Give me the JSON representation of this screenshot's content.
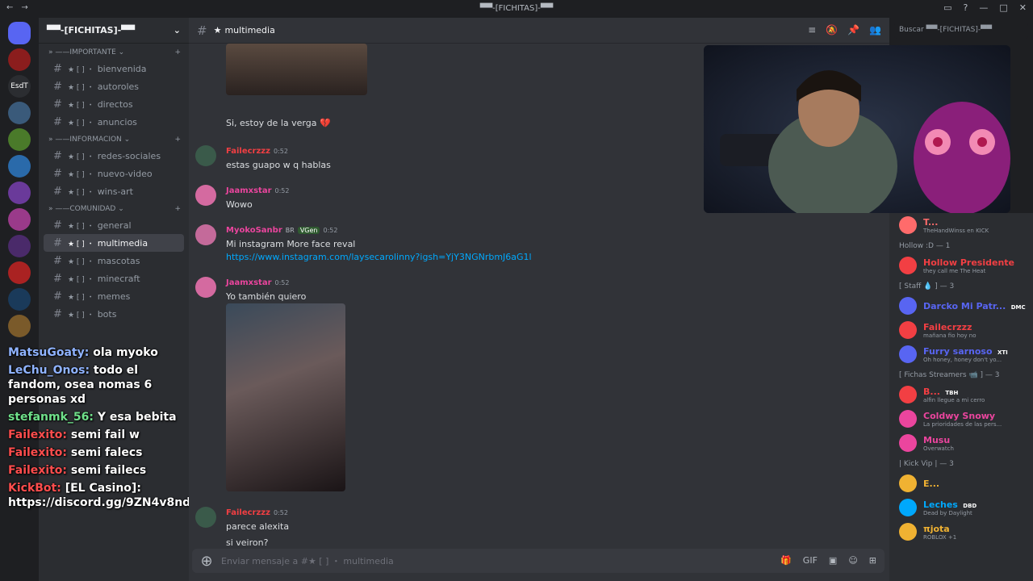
{
  "window": {
    "title": "▀▀-[FICHITAS]-▀▀"
  },
  "server_rail": {
    "items": [
      {
        "label": "",
        "color": "#5865f2",
        "icon": "discord-icon"
      },
      {
        "label": "",
        "color": "#8b1d1d"
      },
      {
        "label": "EsdT",
        "color": "#2b2d31"
      },
      {
        "label": "",
        "color": "#3a5a7a"
      },
      {
        "label": "",
        "color": "#4a7a2a"
      },
      {
        "label": "",
        "color": "#2a6aaa"
      },
      {
        "label": "",
        "color": "#6a3a9a"
      },
      {
        "label": "",
        "color": "#9a3a8a"
      },
      {
        "label": "",
        "color": "#4a2a6a"
      },
      {
        "label": "",
        "color": "#aa2222"
      },
      {
        "label": "",
        "color": "#1a3a5a"
      },
      {
        "label": "",
        "color": "#7a5a2a"
      }
    ]
  },
  "guild": {
    "name": "▀▀-[FICHITAS]-▀▀"
  },
  "sidebar": {
    "categories": [
      {
        "name": "IMPORTANTE",
        "channels": [
          {
            "name": "bienvenida"
          },
          {
            "name": "autoroles"
          },
          {
            "name": "directos"
          },
          {
            "name": "anuncios"
          }
        ]
      },
      {
        "name": "INFORMACION",
        "channels": [
          {
            "name": "redes-sociales"
          },
          {
            "name": "nuevo-video"
          },
          {
            "name": "wins-art"
          }
        ]
      },
      {
        "name": "COMUNIDAD",
        "channels": [
          {
            "name": "general"
          },
          {
            "name": "multimedia"
          },
          {
            "name": "mascotas"
          },
          {
            "name": "minecraft"
          },
          {
            "name": "memes"
          },
          {
            "name": "bots"
          }
        ]
      }
    ]
  },
  "stream_chat": [
    {
      "user": "MatsuGoaty",
      "text": "ola myoko"
    },
    {
      "user": "LeChu_Onos",
      "text": "todo el fandom, osea nomas 6 personas xd"
    },
    {
      "user": "stefanmk_56",
      "text": "Y esa bebita"
    },
    {
      "user": "Failexito",
      "text": "semi fail w"
    },
    {
      "user": "Failexito",
      "text": "semi falecs"
    },
    {
      "user": "Failexito",
      "text": "semi failecs"
    },
    {
      "user": "KickBot",
      "text": "[EL Casino]: https://discord.gg/9ZN4v8ndxa"
    }
  ],
  "channel": {
    "name": "multimedia",
    "search_placeholder": "Buscar ▀▀-[FICHITAS]-▀▀"
  },
  "messages": [
    {
      "text": "Si, estoy de la verga 💔"
    },
    {
      "author": "Failecrzzz",
      "time": "0:52",
      "lines": [
        "estas guapo w q hablas"
      ],
      "color": "#f23f43"
    },
    {
      "author": "Jaamxstar",
      "time": "0:52",
      "lines": [
        "Wowo"
      ],
      "color": "#eb459e"
    },
    {
      "author": "MyokoSanbr",
      "badge": "BR",
      "tag": "VGen",
      "time": "0:52",
      "lines": [
        "Mi instagram More face reval"
      ],
      "link": "https://www.instagram.com/laysecarolinny?igsh=YjY3NGNrbmJ6aG1l",
      "color": "#eb459e"
    },
    {
      "author": "Jaamxstar",
      "time": "0:52",
      "lines": [
        "Yo también quiero"
      ],
      "color": "#eb459e"
    },
    {
      "author": "Failecrzzz",
      "time": "0:52",
      "lines": [
        "parece alexita",
        "si veiron?"
      ],
      "color": "#f23f43"
    }
  ],
  "composer": {
    "placeholder": "Enviar mensaje a #★ [ ] ・ multimedia"
  },
  "members": {
    "top": {
      "name": "T...",
      "status": "TheHandWinss en KICK",
      "color": "#ff6b6b"
    },
    "groups": [
      {
        "title": "Hollow :D — 1",
        "members": [
          {
            "name": "Hollow Presidente",
            "status": "they call me The Heat",
            "color": "#f23f43"
          }
        ]
      },
      {
        "title": "[ Staff 💧 ] — 3",
        "members": [
          {
            "name": "Darcko Mi Patr...",
            "status": "",
            "tag": "DMC",
            "color": "#5865f2"
          },
          {
            "name": "Failecrzzz",
            "status": "mañana fio hoy no",
            "color": "#f23f43"
          },
          {
            "name": "Furry sarnoso",
            "status": "Oh honey, honey don't yo...",
            "tag": "XTI",
            "color": "#5865f2"
          }
        ]
      },
      {
        "title": "[ Fichas Streamers 📹 ] — 3",
        "members": [
          {
            "name": "B...",
            "status": "alfin llegue a mi cerro",
            "tag": "TBH",
            "color": "#f23f43"
          },
          {
            "name": "Coldwy Snowy",
            "status": "La prioridades de las pers...",
            "color": "#eb459e"
          },
          {
            "name": "Musu",
            "status": "Overwatch",
            "color": "#eb459e"
          }
        ]
      },
      {
        "title": "| Kick Vip | — 3",
        "members": [
          {
            "name": "E...",
            "status": "",
            "color": "#f0b232"
          },
          {
            "name": "Leches",
            "status": "Dead by Daylight",
            "tag": "DBD",
            "color": "#00a8fc"
          },
          {
            "name": "πjota",
            "status": "ROBLOX +1",
            "color": "#f0b232"
          }
        ]
      }
    ]
  }
}
